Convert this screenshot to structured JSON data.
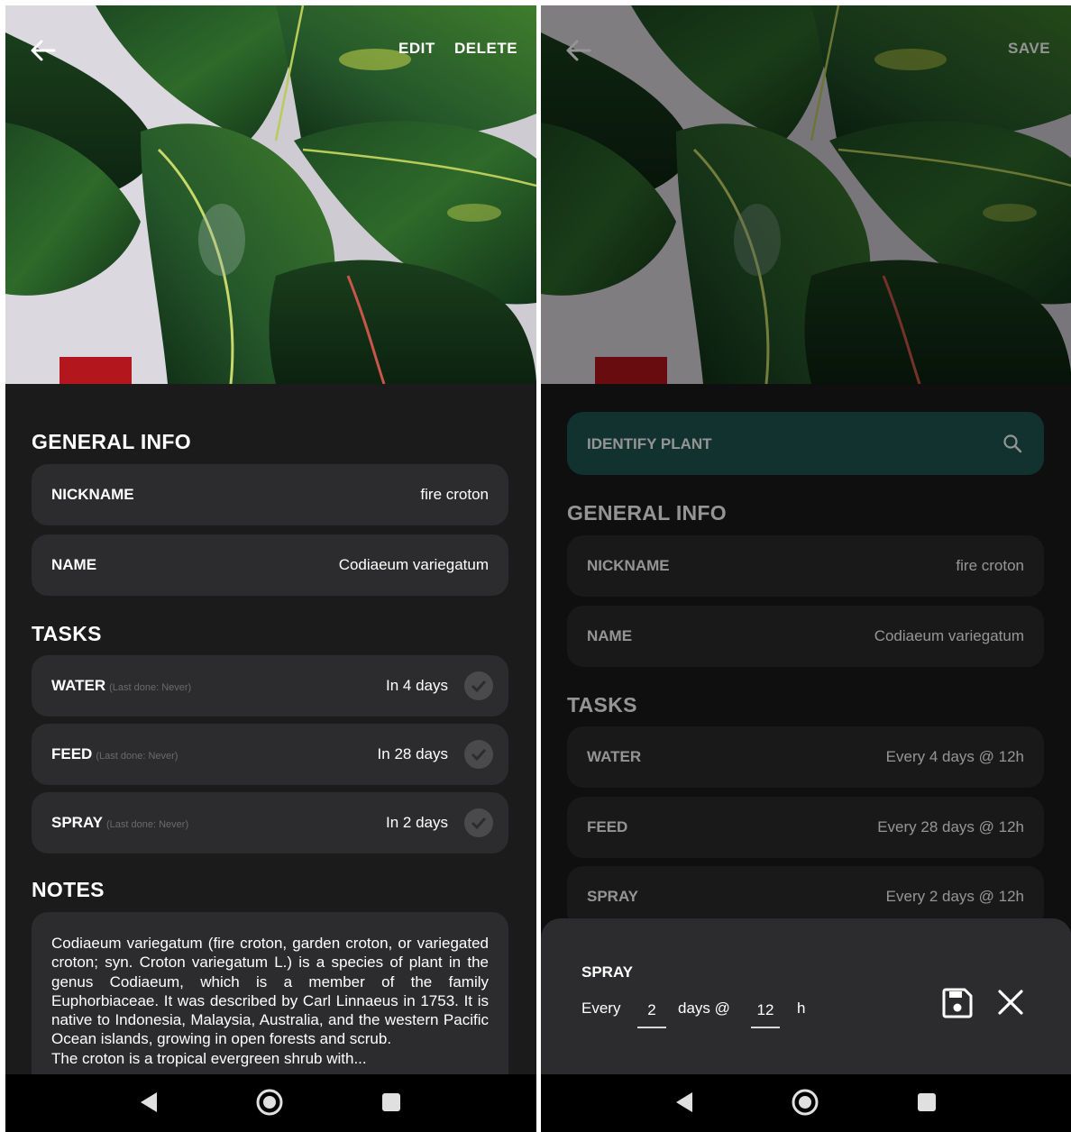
{
  "left_screen": {
    "topbar": {
      "edit_label": "EDIT",
      "delete_label": "DELETE"
    },
    "general_info": {
      "title": "GENERAL INFO",
      "nickname_label": "NICKNAME",
      "nickname_value": "fire croton",
      "name_label": "NAME",
      "name_value": "Codiaeum variegatum"
    },
    "tasks": {
      "title": "TASKS",
      "items": [
        {
          "label": "WATER",
          "sub": "(Last done: Never)",
          "value": "In 4 days"
        },
        {
          "label": "FEED",
          "sub": "(Last done: Never)",
          "value": "In 28 days"
        },
        {
          "label": "SPRAY",
          "sub": "(Last done: Never)",
          "value": "In 2 days"
        }
      ]
    },
    "notes": {
      "title": "NOTES",
      "text": "Codiaeum variegatum (fire croton, garden croton, or variegated croton; syn. Croton variegatum L.) is a species of plant in the genus Codiaeum, which is a member of the family Euphorbiaceae. It was described by Carl Linnaeus in 1753. It is native to Indonesia, Malaysia, Australia, and the western Pacific Ocean islands, growing in open forests and scrub.",
      "text_more": "The croton is a tropical evergreen shrub with..."
    }
  },
  "right_screen": {
    "topbar": {
      "save_label": "SAVE"
    },
    "identify_label": "IDENTIFY PLANT",
    "general_info": {
      "title": "GENERAL INFO",
      "nickname_label": "NICKNAME",
      "nickname_value": "fire croton",
      "name_label": "NAME",
      "name_value": "Codiaeum variegatum"
    },
    "tasks": {
      "title": "TASKS",
      "items": [
        {
          "label": "WATER",
          "value": "Every 4 days @ 12h"
        },
        {
          "label": "FEED",
          "value": "Every 28 days @ 12h"
        },
        {
          "label": "SPRAY",
          "value": "Every 2 days @ 12h"
        }
      ]
    },
    "sheet": {
      "title": "SPRAY",
      "every_label": "Every",
      "days_value": "2",
      "days_label": "days @",
      "hour_value": "12",
      "hour_label": "h"
    }
  },
  "icons": {
    "back": "arrow-left-icon",
    "check": "check-circle-icon",
    "search": "search-icon",
    "save": "floppy-disk-icon",
    "close": "close-icon",
    "nav_back": "nav-back-triangle-icon",
    "nav_home": "nav-home-circle-icon",
    "nav_recents": "nav-recents-square-icon"
  },
  "colors": {
    "background": "#1b1b1c",
    "card": "#2c2c2e",
    "identify_button": "#1f5651",
    "text": "#ffffff"
  }
}
